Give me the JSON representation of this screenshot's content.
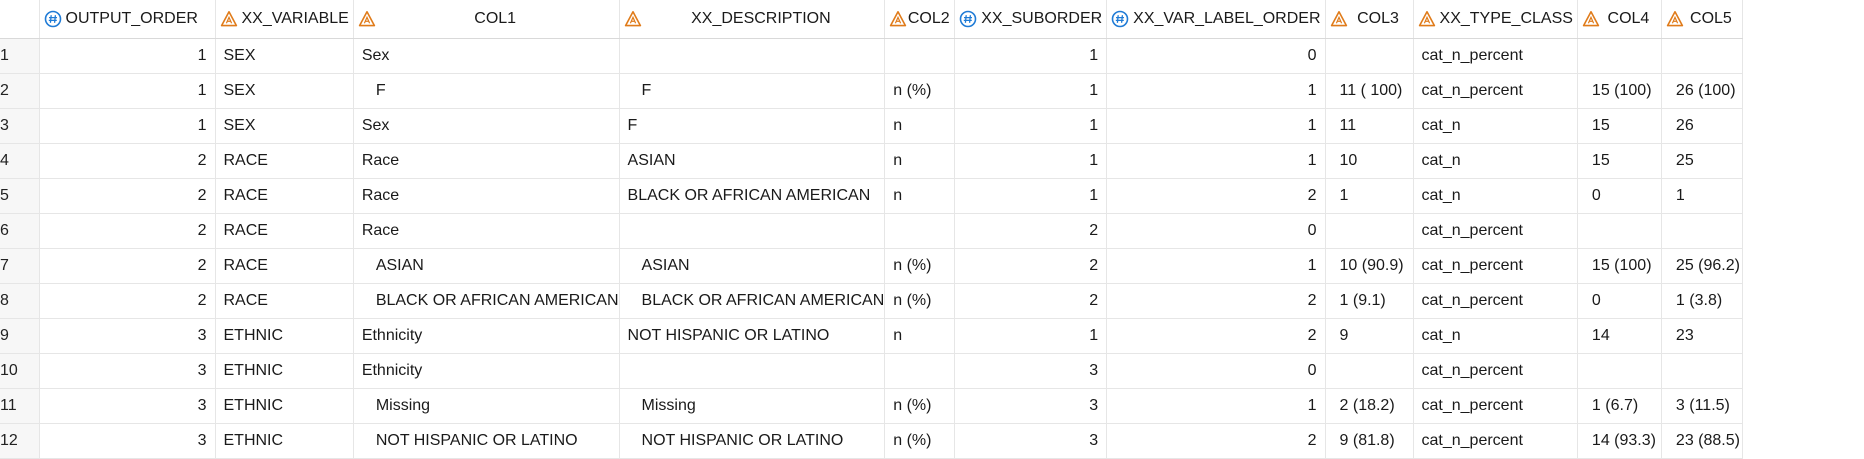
{
  "columns": [
    {
      "label": "OUTPUT_ORDER",
      "icon": "numeric-column-icon"
    },
    {
      "label": "XX_VARIABLE",
      "icon": "character-column-icon"
    },
    {
      "label": "COL1",
      "icon": "character-column-icon"
    },
    {
      "label": "XX_DESCRIPTION",
      "icon": "character-column-icon"
    },
    {
      "label": "COL2",
      "icon": "character-column-icon"
    },
    {
      "label": "XX_SUBORDER",
      "icon": "numeric-column-icon"
    },
    {
      "label": "XX_VAR_LABEL_ORDER",
      "icon": "numeric-column-icon"
    },
    {
      "label": "COL3",
      "icon": "character-column-icon"
    },
    {
      "label": "XX_TYPE_CLASS",
      "icon": "character-column-icon"
    },
    {
      "label": "COL4",
      "icon": "character-column-icon"
    },
    {
      "label": "COL5",
      "icon": "character-column-icon"
    }
  ],
  "colors": {
    "numeric_icon": "#1f7bd6",
    "character_icon": "#e07b1a"
  },
  "rows": [
    {
      "n": "1",
      "output_order": "1",
      "xx_variable": "SEX",
      "col1": "Sex",
      "xx_description": "",
      "col2": "",
      "xx_suborder": "1",
      "xx_var_label_order": "0",
      "col3": "",
      "xx_type_class": "cat_n_percent",
      "col4": "",
      "col5": ""
    },
    {
      "n": "2",
      "output_order": "1",
      "xx_variable": "SEX",
      "col1": "F",
      "xx_description": "F",
      "col2": "n (%)",
      "xx_suborder": "1",
      "xx_var_label_order": "1",
      "col3": "11  ( 100)",
      "xx_type_class": "cat_n_percent",
      "col4": "15  (100)",
      "col5": "26  (100)"
    },
    {
      "n": "3",
      "output_order": "1",
      "xx_variable": "SEX",
      "col1": "Sex",
      "xx_description": "F",
      "col2": "n",
      "xx_suborder": "1",
      "xx_var_label_order": "1",
      "col3": "11",
      "xx_type_class": "cat_n",
      "col4": "15",
      "col5": "26"
    },
    {
      "n": "4",
      "output_order": "2",
      "xx_variable": "RACE",
      "col1": "Race",
      "xx_description": "ASIAN",
      "col2": "n",
      "xx_suborder": "1",
      "xx_var_label_order": "1",
      "col3": "10",
      "xx_type_class": "cat_n",
      "col4": "15",
      "col5": "25"
    },
    {
      "n": "5",
      "output_order": "2",
      "xx_variable": "RACE",
      "col1": "Race",
      "xx_description": "BLACK OR AFRICAN AMERICAN",
      "col2": "n",
      "xx_suborder": "1",
      "xx_var_label_order": "2",
      "col3": "1",
      "xx_type_class": "cat_n",
      "col4": "0",
      "col5": "1"
    },
    {
      "n": "6",
      "output_order": "2",
      "xx_variable": "RACE",
      "col1": "Race",
      "xx_description": "",
      "col2": "",
      "xx_suborder": "2",
      "xx_var_label_order": "0",
      "col3": "",
      "xx_type_class": "cat_n_percent",
      "col4": "",
      "col5": ""
    },
    {
      "n": "7",
      "output_order": "2",
      "xx_variable": "RACE",
      "col1": "ASIAN",
      "xx_description": "ASIAN",
      "col2": "n (%)",
      "xx_suborder": "2",
      "xx_var_label_order": "1",
      "col3": "10 (90.9)",
      "xx_type_class": "cat_n_percent",
      "col4": "15  (100)",
      "col5": "25 (96.2)"
    },
    {
      "n": "8",
      "output_order": "2",
      "xx_variable": "RACE",
      "col1": "BLACK OR AFRICAN AMERICAN",
      "xx_description": "BLACK OR AFRICAN AMERICAN",
      "col2": "n (%)",
      "xx_suborder": "2",
      "xx_var_label_order": "2",
      "col3": "1  (9.1)",
      "xx_type_class": "cat_n_percent",
      "col4": "0",
      "col5": "1  (3.8)"
    },
    {
      "n": "9",
      "output_order": "3",
      "xx_variable": "ETHNIC",
      "col1": "Ethnicity",
      "xx_description": "NOT HISPANIC OR LATINO",
      "col2": "n",
      "xx_suborder": "1",
      "xx_var_label_order": "2",
      "col3": "9",
      "xx_type_class": "cat_n",
      "col4": "14",
      "col5": "23"
    },
    {
      "n": "10",
      "output_order": "3",
      "xx_variable": "ETHNIC",
      "col1": "Ethnicity",
      "xx_description": "",
      "col2": "",
      "xx_suborder": "3",
      "xx_var_label_order": "0",
      "col3": "",
      "xx_type_class": "cat_n_percent",
      "col4": "",
      "col5": ""
    },
    {
      "n": "11",
      "output_order": "3",
      "xx_variable": "ETHNIC",
      "col1": "Missing",
      "xx_description": "Missing",
      "col2": "n (%)",
      "xx_suborder": "3",
      "xx_var_label_order": "1",
      "col3": "2  (18.2)",
      "xx_type_class": "cat_n_percent",
      "col4": "1  (6.7)",
      "col5": "3  (11.5)"
    },
    {
      "n": "12",
      "output_order": "3",
      "xx_variable": "ETHNIC",
      "col1": "NOT HISPANIC OR LATINO",
      "xx_description": "NOT HISPANIC OR LATINO",
      "col2": "n (%)",
      "xx_suborder": "3",
      "xx_var_label_order": "2",
      "col3": "9  (81.8)",
      "xx_type_class": "cat_n_percent",
      "col4": "14 (93.3)",
      "col5": "23 (88.5)"
    }
  ]
}
